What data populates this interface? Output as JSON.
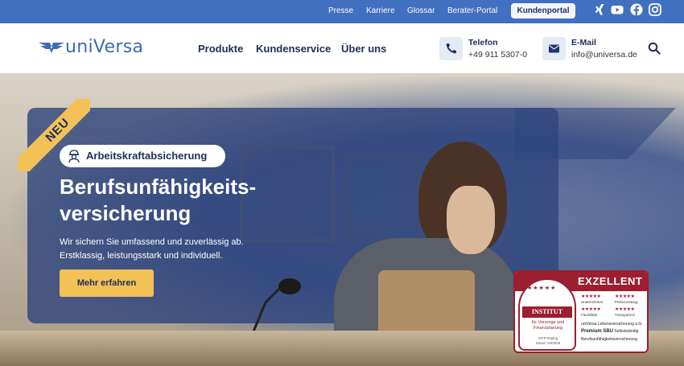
{
  "topbar": {
    "links": [
      "Presse",
      "Karriere",
      "Glossar",
      "Berater-Portal"
    ],
    "portal_button": "Kundenportal",
    "social": [
      "xing-icon",
      "youtube-icon",
      "facebook-icon",
      "instagram-icon"
    ]
  },
  "header": {
    "logo_text": "uniVersa",
    "nav": [
      "Produkte",
      "Kundenservice",
      "Über uns"
    ],
    "phone": {
      "title": "Telefon",
      "value": "+49 911 5307-0"
    },
    "email": {
      "title": "E-Mail",
      "value": "info@universa.de"
    }
  },
  "hero": {
    "badge": "NEU",
    "tag": "Arbeitskraftabsicherung",
    "headline_line1": "Berufsunfähigkeits-",
    "headline_line2": "versicherung",
    "subline_line1": "Wir sichern Sie umfassend und zuverlässig ab.",
    "subline_line2": "Erstklassig, leistungsstark und individuell.",
    "cta": "Mehr erfahren"
  },
  "seal": {
    "rating": "EXZELLENT",
    "institute": "INSTITUT",
    "institute_sub_line1": "für Vorsorge und",
    "institute_sub_line2": "Finanzplanung",
    "date_line1": "IVFP-Rating",
    "date_line2": "Stand: 04/2025",
    "criteria": [
      "Unternehmen",
      "Preis/Leistung",
      "Flexibilität",
      "Transparenz"
    ],
    "company": "uniVersa Lebensversicherung a.G.",
    "product_bold": "Premium SBU",
    "product_rest": "Selbstständig",
    "category": "Berufsunfähigkeitsversicherung"
  },
  "colors": {
    "topbar": "#4170c0",
    "brand_navy": "#1d2f55",
    "accent_yellow": "#f3c156",
    "seal_red": "#9b1f2e"
  }
}
